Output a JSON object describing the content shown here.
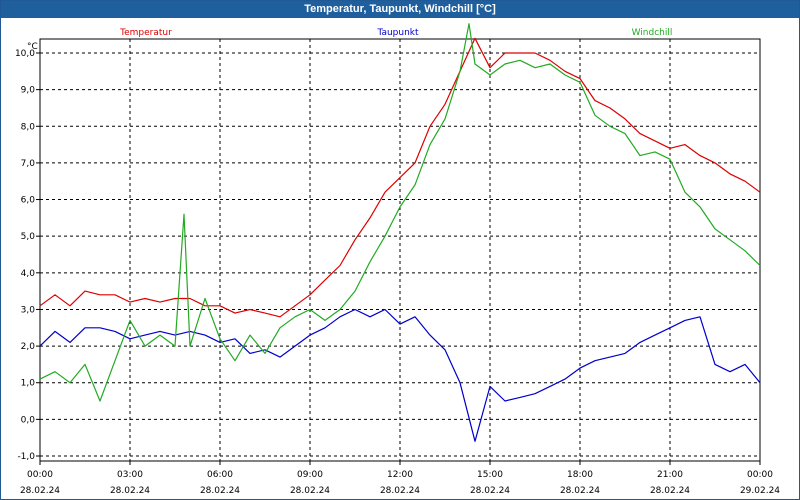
{
  "window": {
    "title": "Temperatur, Taupunkt, Windchill [°C]"
  },
  "chart_data": {
    "type": "line",
    "title": "Temperatur, Taupunkt, Windchill [°C]",
    "ylabel": "°C",
    "xlabel": "",
    "ylim": [
      -1.0,
      11.0
    ],
    "xlim_hours": [
      0,
      24
    ],
    "grid": true,
    "y_ticks": [
      "-1,0",
      "0,0",
      "1,0",
      "2,0",
      "3,0",
      "4,0",
      "5,0",
      "6,0",
      "7,0",
      "8,0",
      "9,0",
      "10,0"
    ],
    "x_ticks": [
      {
        "time": "00:00",
        "date": "28.02.24"
      },
      {
        "time": "03:00",
        "date": "28.02.24"
      },
      {
        "time": "06:00",
        "date": "28.02.24"
      },
      {
        "time": "09:00",
        "date": "28.02.24"
      },
      {
        "time": "12:00",
        "date": "28.02.24"
      },
      {
        "time": "15:00",
        "date": "28.02.24"
      },
      {
        "time": "18:00",
        "date": "28.02.24"
      },
      {
        "time": "21:00",
        "date": "28.02.24"
      },
      {
        "time": "00:00",
        "date": "29.02.24"
      }
    ],
    "series": [
      {
        "name": "Temperatur",
        "color": "#dd0000",
        "x_hours": [
          0,
          0.5,
          1,
          1.5,
          2,
          2.5,
          3,
          3.5,
          4,
          4.5,
          5,
          5.5,
          6,
          6.5,
          7,
          7.5,
          8,
          8.5,
          9,
          9.5,
          10,
          10.5,
          11,
          11.5,
          12,
          12.5,
          13,
          13.5,
          14,
          14.5,
          15,
          15.5,
          16,
          16.5,
          17,
          17.5,
          18,
          18.5,
          19,
          19.5,
          20,
          20.5,
          21,
          21.5,
          22,
          22.5,
          23,
          23.5,
          24
        ],
        "values": [
          3.1,
          3.4,
          3.1,
          3.5,
          3.4,
          3.4,
          3.2,
          3.3,
          3.2,
          3.3,
          3.3,
          3.1,
          3.1,
          2.9,
          3.0,
          2.9,
          2.8,
          3.1,
          3.4,
          3.8,
          4.2,
          4.9,
          5.5,
          6.2,
          6.6,
          7.0,
          8.0,
          8.6,
          9.5,
          10.4,
          9.6,
          10.0,
          10.0,
          10.0,
          9.8,
          9.5,
          9.3,
          8.7,
          8.5,
          8.2,
          7.8,
          7.6,
          7.4,
          7.5,
          7.2,
          7.0,
          6.7,
          6.5,
          6.2
        ]
      },
      {
        "name": "Taupunkt",
        "color": "#0000cc",
        "x_hours": [
          0,
          0.5,
          1,
          1.5,
          2,
          2.5,
          3,
          3.5,
          4,
          4.5,
          5,
          5.5,
          6,
          6.5,
          7,
          7.5,
          8,
          8.5,
          9,
          9.5,
          10,
          10.5,
          11,
          11.5,
          12,
          12.5,
          13,
          13.5,
          14,
          14.5,
          15,
          15.5,
          16,
          16.5,
          17,
          17.5,
          18,
          18.5,
          19,
          19.5,
          20,
          20.5,
          21,
          21.5,
          22,
          22.5,
          23,
          23.5,
          24
        ],
        "values": [
          2.0,
          2.4,
          2.1,
          2.5,
          2.5,
          2.4,
          2.2,
          2.3,
          2.4,
          2.3,
          2.4,
          2.3,
          2.1,
          2.2,
          1.8,
          1.9,
          1.7,
          2.0,
          2.3,
          2.5,
          2.8,
          3.0,
          2.8,
          3.0,
          2.6,
          2.8,
          2.3,
          1.9,
          1.0,
          -0.6,
          0.9,
          0.5,
          0.6,
          0.7,
          0.9,
          1.1,
          1.4,
          1.6,
          1.7,
          1.8,
          2.1,
          2.3,
          2.5,
          2.7,
          2.8,
          1.5,
          1.3,
          1.5,
          1.0
        ]
      },
      {
        "name": "Windchill",
        "color": "#22aa22",
        "x_hours": [
          0,
          0.5,
          1,
          1.5,
          2,
          2.5,
          3,
          3.5,
          4,
          4.5,
          4.8,
          5,
          5.5,
          6,
          6.5,
          7,
          7.5,
          8,
          8.5,
          9,
          9.5,
          10,
          10.5,
          11,
          11.5,
          12,
          12.5,
          13,
          13.5,
          14,
          14.3,
          14.5,
          15,
          15.5,
          16,
          16.5,
          17,
          17.5,
          18,
          18.5,
          19,
          19.5,
          20,
          20.5,
          21,
          21.5,
          22,
          22.5,
          23,
          23.5,
          24
        ],
        "values": [
          1.1,
          1.3,
          1.0,
          1.5,
          0.5,
          1.6,
          2.7,
          2.0,
          2.3,
          2.0,
          5.6,
          2.0,
          3.3,
          2.2,
          1.6,
          2.3,
          1.8,
          2.5,
          2.8,
          3.0,
          2.7,
          3.0,
          3.5,
          4.3,
          5.0,
          5.8,
          6.4,
          7.5,
          8.2,
          9.5,
          10.8,
          9.7,
          9.4,
          9.7,
          9.8,
          9.6,
          9.7,
          9.4,
          9.2,
          8.3,
          8.0,
          7.8,
          7.2,
          7.3,
          7.1,
          6.2,
          5.8,
          5.2,
          4.9,
          4.6,
          4.2
        ]
      }
    ]
  }
}
